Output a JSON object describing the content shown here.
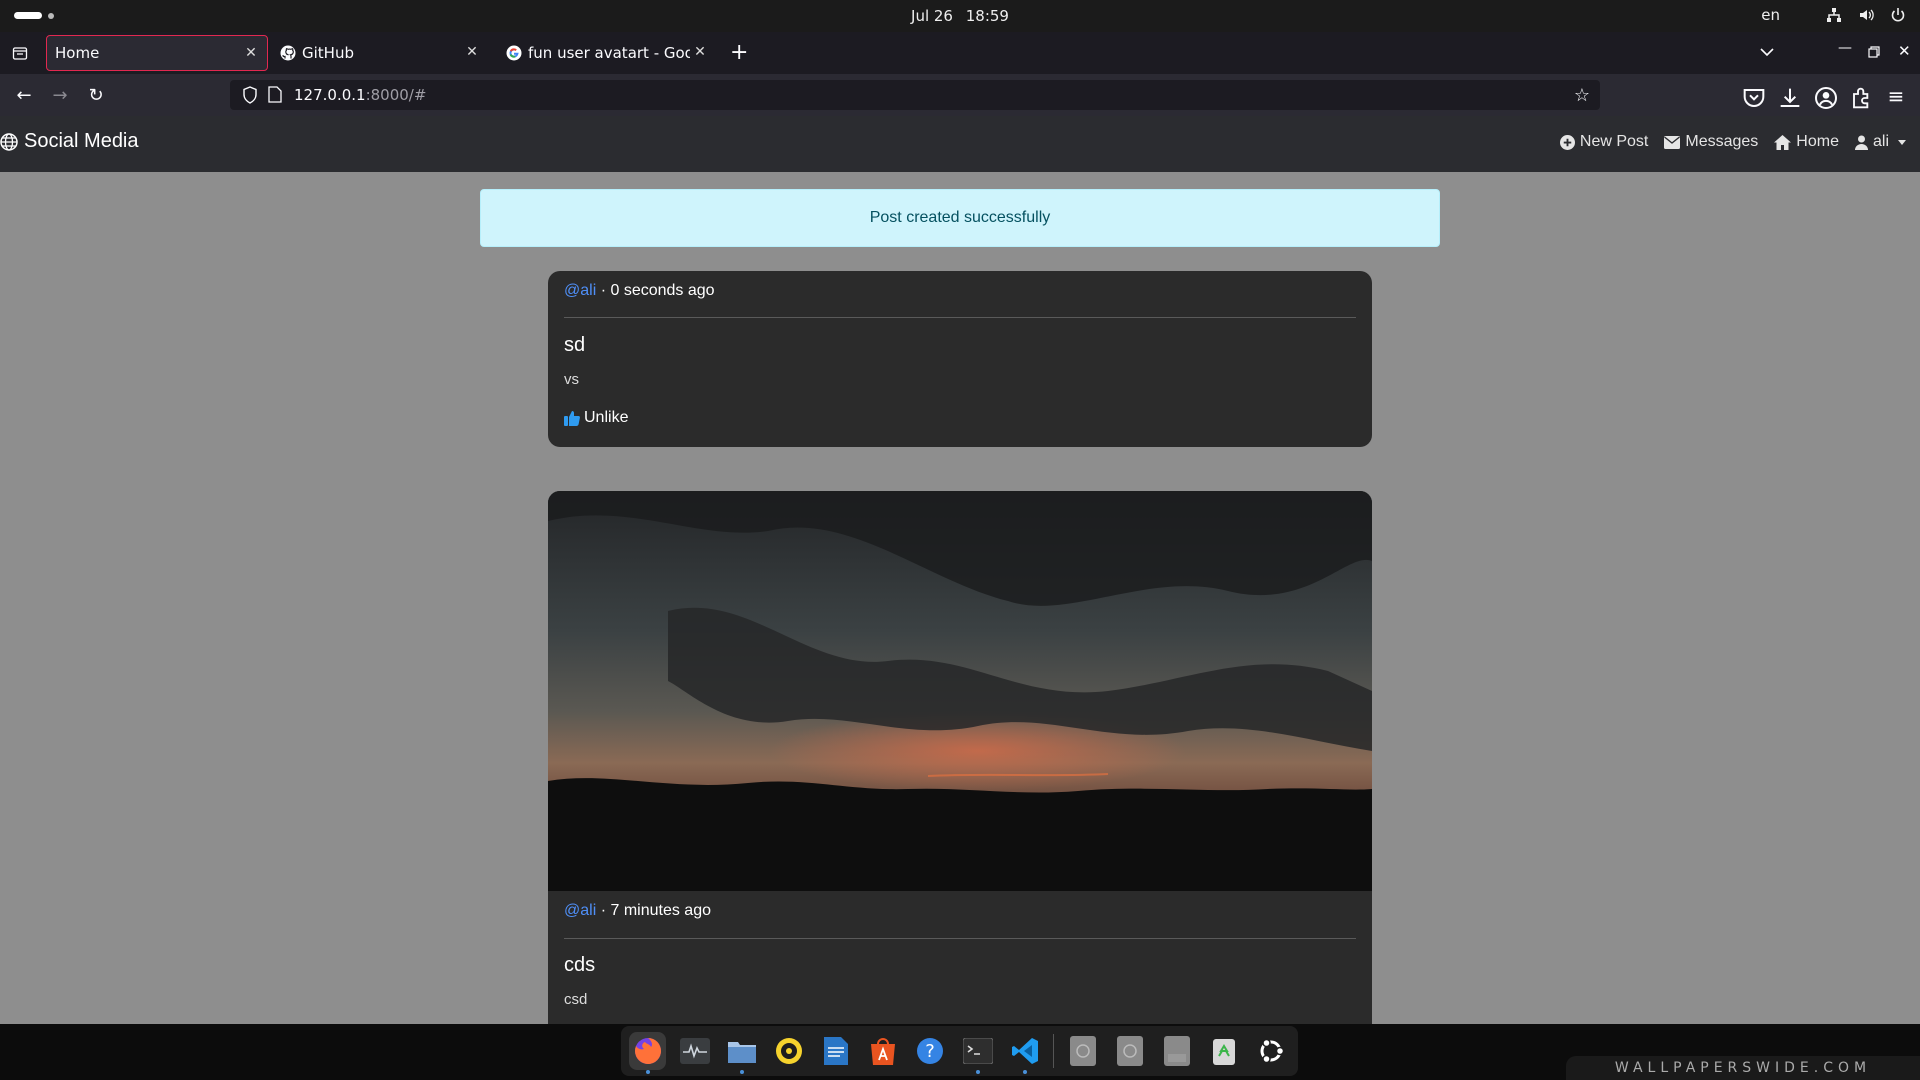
{
  "system": {
    "date": "Jul 26",
    "time": "18:59",
    "language": "en",
    "tray_icons": [
      "network-icon",
      "volume-icon",
      "power-icon"
    ]
  },
  "browser": {
    "tabs": [
      {
        "label": "Home",
        "active": true,
        "icon": "page-icon"
      },
      {
        "label": "GitHub",
        "active": false,
        "icon": "github-icon"
      },
      {
        "label": "fun user avatart - Google",
        "active": false,
        "icon": "google-icon"
      }
    ],
    "url_host": "127.0.0.1",
    "url_path": ":8000/#"
  },
  "site": {
    "brand": "Social Media",
    "nav": {
      "new_post": "New Post",
      "messages": "Messages",
      "home": "Home",
      "user": "ali"
    }
  },
  "alert": "Post created successfully",
  "posts": [
    {
      "author": "@ali",
      "separator": "·",
      "time": "0 seconds ago",
      "title": "sd",
      "body": "vs",
      "like_label": "Unlike",
      "has_image": false
    },
    {
      "author": "@ali",
      "separator": "·",
      "time": "7 minutes ago",
      "title": "cds",
      "body": "csd",
      "has_image": true
    }
  ],
  "watermark": "WALLPAPERSWIDE.COM",
  "colors": {
    "accent_tab": "#e22850",
    "link": "#4f8ff7",
    "alert_bg": "#cff4fc",
    "alert_text": "#055160"
  }
}
